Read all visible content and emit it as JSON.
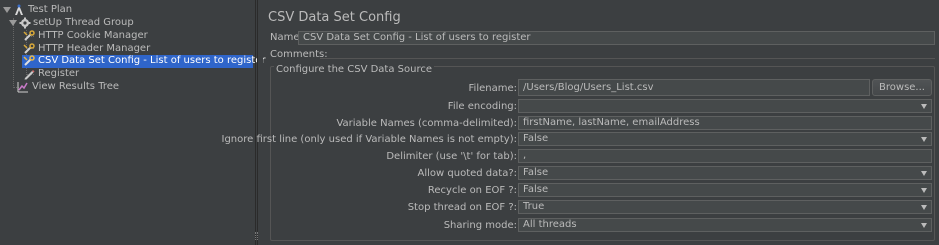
{
  "tree": {
    "items": [
      {
        "label": "Test Plan"
      },
      {
        "label": "setUp Thread Group"
      },
      {
        "label": "HTTP Cookie Manager"
      },
      {
        "label": "HTTP Header Manager"
      },
      {
        "label": "CSV Data Set Config - List of users to register"
      },
      {
        "label": "Register"
      },
      {
        "label": "View Results Tree"
      }
    ]
  },
  "panel": {
    "title": "CSV Data Set Config",
    "name_label": "Name:",
    "name_value": "CSV Data Set Config - List of users to register",
    "comments_label": "Comments:",
    "group_title": "Configure the CSV Data Source",
    "filename_label": "Filename:",
    "filename_value": "/Users/Blog/Users_List.csv",
    "browse_label": "Browse...",
    "encoding_label": "File encoding:",
    "encoding_value": "",
    "varnames_label": "Variable Names (comma-delimited):",
    "varnames_value": "firstName, lastName, emailAddress",
    "ignore_label": "Ignore first line (only used if Variable Names is not empty):",
    "ignore_value": "False",
    "delimiter_label": "Delimiter (use '\\t' for tab):",
    "delimiter_value": ",",
    "quoted_label": "Allow quoted data?:",
    "quoted_value": "False",
    "recycle_label": "Recycle on EOF ?:",
    "recycle_value": "False",
    "stop_label": "Stop thread on EOF ?:",
    "stop_value": "True",
    "sharing_label": "Sharing mode:",
    "sharing_value": "All threads"
  },
  "icons": {
    "test_plan": "test-plan-icon",
    "thread_group": "gear-icon",
    "config": "wrench-icon",
    "sampler": "pencil-icon",
    "listener": "chart-icon"
  },
  "colors": {
    "background": "#3c3f41",
    "selection": "#2f65ca",
    "field": "#45494a",
    "text": "#bbbbbb"
  }
}
